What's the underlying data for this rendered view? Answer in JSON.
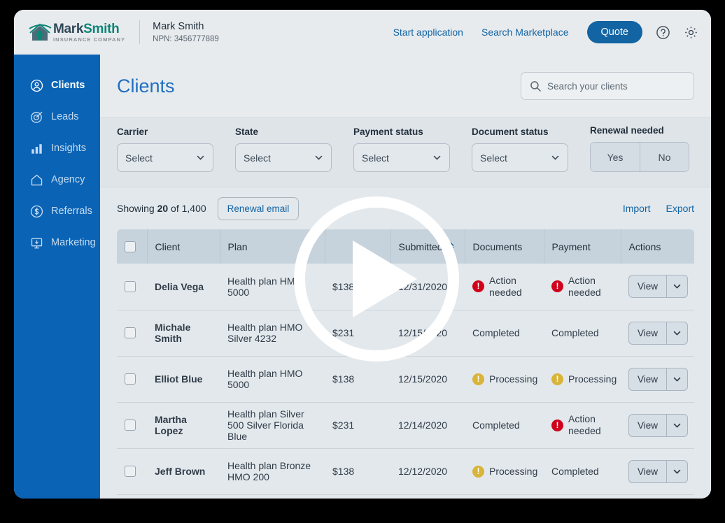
{
  "brand": {
    "logo_name_dark": "Mark",
    "logo_name_teal": "Smith",
    "logo_subtitle": "INSURANCE COMPANY"
  },
  "header": {
    "user_name": "Mark Smith",
    "npn": "NPN: 3456777889",
    "links": [
      {
        "label": "Start application"
      },
      {
        "label": "Search Marketplace"
      }
    ],
    "quote_label": "Quote",
    "help_icon": "help-circle-icon",
    "settings_icon": "gear-icon",
    "accent_color": "#1264A3"
  },
  "sidebar": {
    "background_color": "#0B63B5",
    "items": [
      {
        "label": "Clients",
        "icon": "user-circle-icon",
        "active": true
      },
      {
        "label": "Leads",
        "icon": "target-icon",
        "active": false
      },
      {
        "label": "Insights",
        "icon": "bar-chart-icon",
        "active": false
      },
      {
        "label": "Agency",
        "icon": "home-icon",
        "active": false
      },
      {
        "label": "Referrals",
        "icon": "dollar-circle-icon",
        "active": false
      },
      {
        "label": "Marketing",
        "icon": "monitor-icon",
        "active": false
      }
    ]
  },
  "page": {
    "title": "Clients",
    "search_placeholder": "Search your clients",
    "search_value": "",
    "search_icon": "search-icon"
  },
  "filters": {
    "carrier": {
      "label": "Carrier",
      "value": "Select"
    },
    "state": {
      "label": "State",
      "value": "Select"
    },
    "payment_status": {
      "label": "Payment status",
      "value": "Select"
    },
    "document_status": {
      "label": "Document status",
      "value": "Select"
    },
    "renewal_needed": {
      "label": "Renewal needed",
      "yes": "Yes",
      "no": "No"
    }
  },
  "toolbar": {
    "showing_prefix": "Showing ",
    "showing_count": "20",
    "showing_suffix": " of 1,400",
    "renewal_email_label": "Renewal email",
    "import_label": "Import",
    "export_label": "Export"
  },
  "table": {
    "columns": [
      {
        "label": ""
      },
      {
        "label": "Client"
      },
      {
        "label": "Plan"
      },
      {
        "label": ""
      },
      {
        "label": "Submitted",
        "sortable": true
      },
      {
        "label": "Documents"
      },
      {
        "label": "Payment"
      },
      {
        "label": "Actions"
      }
    ],
    "sort_icon": "sort-chevrons-icon",
    "action_label": "View",
    "action_chevron_icon": "chevron-down-icon",
    "rows": [
      {
        "client": "Delia Vega",
        "plan": "Health plan HMO 5000",
        "premium": "$138",
        "submitted": "12/31/2020",
        "documents": {
          "text": "Action needed",
          "state": "error"
        },
        "payment": {
          "text": "Action needed",
          "state": "error"
        }
      },
      {
        "client": "Michale Smith",
        "plan": "Health plan HMO Silver 4232",
        "premium": "$231",
        "submitted": "12/15/2020",
        "documents": {
          "text": "Completed",
          "state": "done"
        },
        "payment": {
          "text": "Completed",
          "state": "done"
        }
      },
      {
        "client": "Elliot Blue",
        "plan": "Health plan HMO 5000",
        "premium": "$138",
        "submitted": "12/15/2020",
        "documents": {
          "text": "Processing",
          "state": "pending"
        },
        "payment": {
          "text": "Processing",
          "state": "pending"
        }
      },
      {
        "client": "Martha Lopez",
        "plan": "Health plan Silver 500 Silver Florida Blue",
        "premium": "$231",
        "submitted": "12/14/2020",
        "documents": {
          "text": "Completed",
          "state": "done"
        },
        "payment": {
          "text": "Action needed",
          "state": "error"
        }
      },
      {
        "client": "Jeff Brown",
        "plan": "Health plan Bronze HMO 200",
        "premium": "$138",
        "submitted": "12/12/2020",
        "documents": {
          "text": "Processing",
          "state": "pending"
        },
        "payment": {
          "text": "Completed",
          "state": "done"
        }
      }
    ]
  },
  "overlay": {
    "play_icon": "play-button-icon"
  },
  "colors": {
    "error": "#D0021B",
    "pending": "#D8B43A",
    "link": "#1264A3",
    "sidebar": "#0B63B5"
  }
}
